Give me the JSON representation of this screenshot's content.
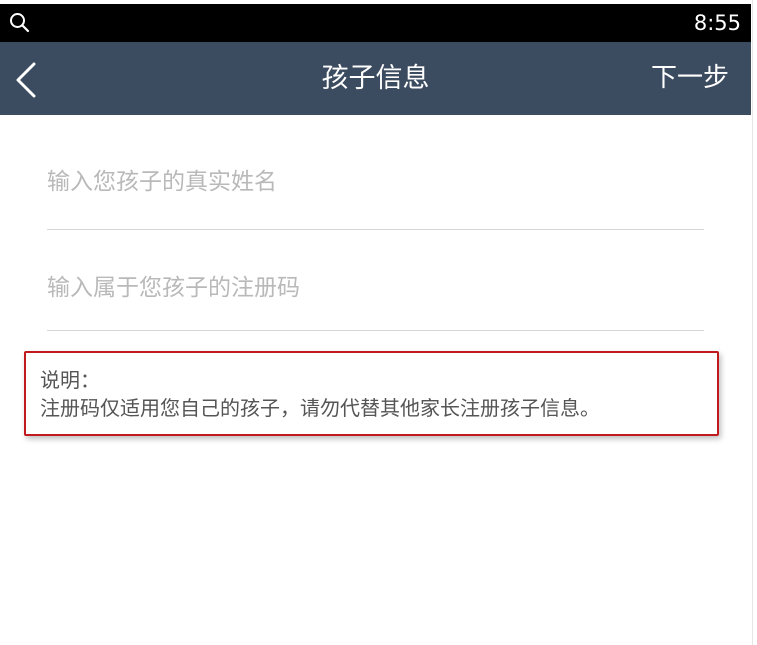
{
  "status_bar": {
    "time": "8:55",
    "left_icon": "search-icon"
  },
  "nav": {
    "back_icon": "chevron-left-icon",
    "title": "孩子信息",
    "next_label": "下一步"
  },
  "form": {
    "child_name_placeholder": "输入您孩子的真实姓名",
    "child_name_value": "",
    "registration_code_placeholder": "输入属于您孩子的注册码",
    "registration_code_value": ""
  },
  "note": {
    "title": "说明：",
    "text": "注册码仅适用您自己的孩子，请勿代替其他家长注册孩子信息。"
  },
  "colors": {
    "nav_background": "#3b4b60",
    "status_background": "#000000",
    "highlight_border": "#c0191e",
    "placeholder": "#b9b9b9"
  }
}
